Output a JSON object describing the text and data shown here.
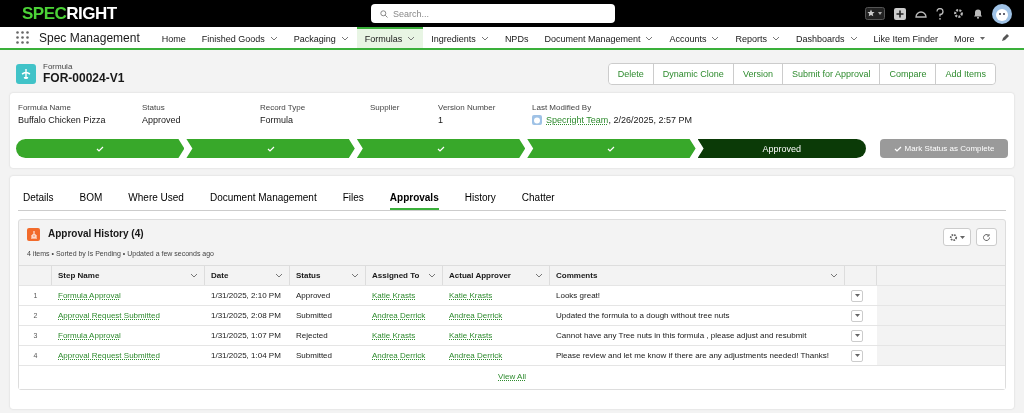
{
  "brand": {
    "part_1": "SPEC",
    "part_2": "RIGHT"
  },
  "search": {
    "placeholder": "Search..."
  },
  "app_name": "Spec Management",
  "nav": [
    {
      "label": "Home",
      "menu": false,
      "selected": false
    },
    {
      "label": "Finished Goods",
      "menu": true,
      "selected": false
    },
    {
      "label": "Packaging",
      "menu": true,
      "selected": false
    },
    {
      "label": "Formulas",
      "menu": true,
      "selected": true
    },
    {
      "label": "Ingredients",
      "menu": true,
      "selected": false
    },
    {
      "label": "NPDs",
      "menu": false,
      "selected": false
    },
    {
      "label": "Document Management",
      "menu": true,
      "selected": false
    },
    {
      "label": "Accounts",
      "menu": true,
      "selected": false
    },
    {
      "label": "Reports",
      "menu": true,
      "selected": false
    },
    {
      "label": "Dashboards",
      "menu": true,
      "selected": false
    },
    {
      "label": "Like Item Finder",
      "menu": false,
      "selected": false
    },
    {
      "label": "More",
      "menu": true,
      "selected": false
    }
  ],
  "record": {
    "object": "Formula",
    "name": "FOR-00024-V1"
  },
  "actions": [
    "Delete",
    "Dynamic Clone",
    "Version",
    "Submit for Approval",
    "Compare",
    "Add Items"
  ],
  "fields": [
    {
      "label": "Formula Name",
      "value": "Buffalo Chicken Pizza"
    },
    {
      "label": "Status",
      "value": "Approved"
    },
    {
      "label": "Record Type",
      "value": "Formula"
    },
    {
      "label": "Supplier"
    },
    {
      "label": "Version Number",
      "value": "1"
    }
  ],
  "last_modified": {
    "label": "Last Modified By",
    "user": "Specright Team",
    "date": ", 2/26/2025, 2:57 PM"
  },
  "path": [
    {
      "complete": true
    },
    {
      "complete": true
    },
    {
      "complete": true
    },
    {
      "complete": true
    },
    {
      "complete": false,
      "label": "Approved"
    }
  ],
  "mark_complete": {
    "label": "Mark Status as Complete",
    "disabled": true
  },
  "tabs": [
    {
      "label": "Details",
      "selected": false
    },
    {
      "label": "BOM",
      "selected": false
    },
    {
      "label": "Where Used",
      "selected": false
    },
    {
      "label": "Document Management",
      "selected": false
    },
    {
      "label": "Files",
      "selected": false
    },
    {
      "label": "Approvals",
      "selected": true
    },
    {
      "label": "History",
      "selected": false
    },
    {
      "label": "Chatter",
      "selected": false
    }
  ],
  "related_list": {
    "title": "Approval History (4)",
    "meta": "4 items • Sorted by Is Pending • Updated a few seconds ago",
    "view_all": "View All"
  },
  "table": {
    "columns": [
      "Step Name",
      "Date",
      "Status",
      "Assigned To",
      "Actual Approver",
      "Comments"
    ],
    "rows": [
      {
        "n": "1",
        "step": "Formula Approval",
        "date": "1/31/2025, 2:10 PM",
        "status": "Approved",
        "assigned": "Katie Krasts",
        "approver": "Katie Krasts",
        "comment": "Looks great!"
      },
      {
        "n": "2",
        "step": "Approval Request Submitted",
        "date": "1/31/2025, 2:08 PM",
        "status": "Submitted",
        "assigned": "Andrea Derrick",
        "approver": "Andrea Derrick",
        "comment": "Updated the formula to a dough without tree nuts"
      },
      {
        "n": "3",
        "step": "Formula Approval",
        "date": "1/31/2025, 1:07 PM",
        "status": "Rejected",
        "assigned": "Katie Krasts",
        "approver": "Katie Krasts",
        "comment": "Cannot have any Tree nuts in this formula , please adjust and resubmit"
      },
      {
        "n": "4",
        "step": "Approval Request Submitted",
        "date": "1/31/2025, 1:04 PM",
        "status": "Submitted",
        "assigned": "Andrea Derrick",
        "approver": "Andrea Derrick",
        "comment": "Please review and let me know if there are any adjustments needed! Thanks!"
      }
    ]
  }
}
